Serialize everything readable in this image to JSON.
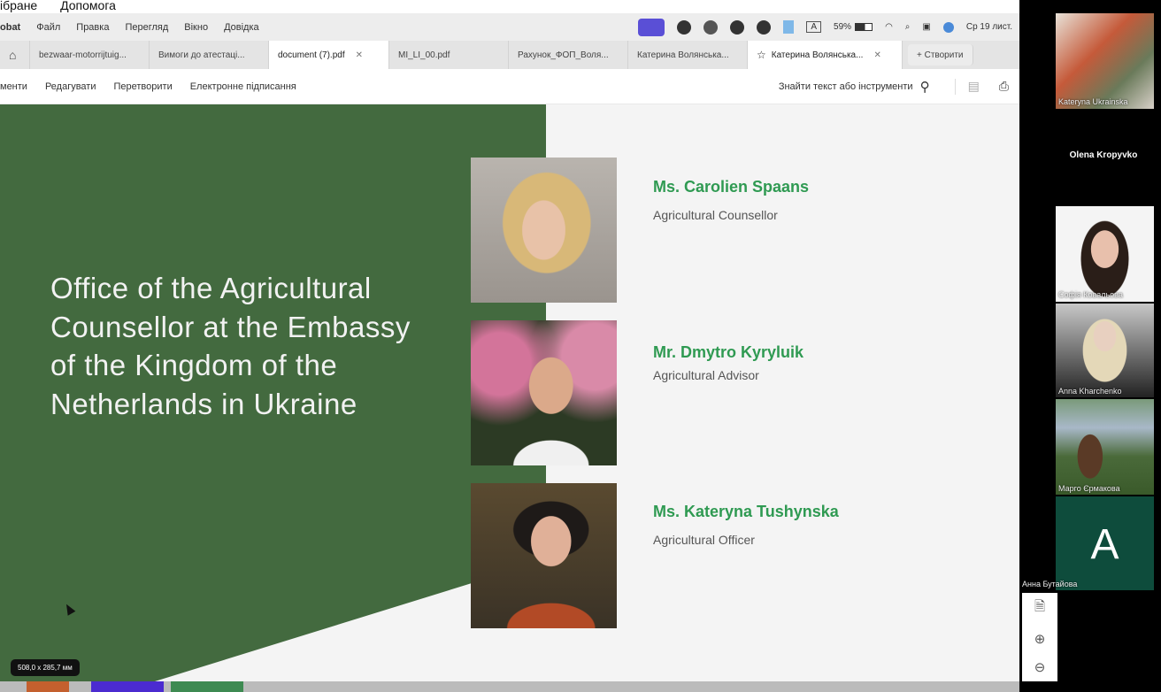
{
  "top_strip": [
    "ібране",
    "Допомога"
  ],
  "menubar": {
    "app": "obat",
    "items": [
      "Файл",
      "Правка",
      "Перегляд",
      "Вікно",
      "Довідка"
    ],
    "battery": "59%",
    "clock": "Ср 19 лист."
  },
  "tabs": [
    {
      "label": "bezwaar-motorrijtuig...",
      "active": false,
      "close": false
    },
    {
      "label": "Вимоги до атестаці...",
      "active": false,
      "close": false
    },
    {
      "label": "document (7).pdf",
      "active": true,
      "close": true
    },
    {
      "label": "MI_LI_00.pdf",
      "active": false,
      "close": false
    },
    {
      "label": "Рахунок_ФОП_Воля...",
      "active": false,
      "close": false
    },
    {
      "label": "Катерина Волянська...",
      "active": false,
      "close": false
    },
    {
      "label": "Катерина Волянська...",
      "active": true,
      "close": true,
      "star": true
    }
  ],
  "new_tab": "+ Створити",
  "toolbar": {
    "items": [
      "менти",
      "Редагувати",
      "Перетворити",
      "Електронне підписання"
    ],
    "search": "Знайти текст або інструменти"
  },
  "slide": {
    "title": "Office of the Agricultural Counsellor at the Embassy of the Kingdom of the Netherlands in Ukraine",
    "people": [
      {
        "name": "Ms. Carolien Spaans",
        "role": "Agricultural Counsellor"
      },
      {
        "name": "Mr. Dmytro Kyryluik",
        "role": "Agricultural Advisor"
      },
      {
        "name": "Ms. Kateryna Tushynska",
        "role": "Agricultural Officer"
      }
    ],
    "green": "#436a3f",
    "accent": "#2f9a52"
  },
  "page_size": "508,0 x 285,7 мм",
  "participants": [
    {
      "name": "Kateryna Ukrainska"
    },
    {
      "name": "Olena Kropyvko"
    },
    {
      "name": "Софія Ковальова"
    },
    {
      "name": "Anna Kharchenko"
    },
    {
      "name": "Марго Єрмакова"
    },
    {
      "name": "Анна Бутайова",
      "initial": "A"
    }
  ]
}
